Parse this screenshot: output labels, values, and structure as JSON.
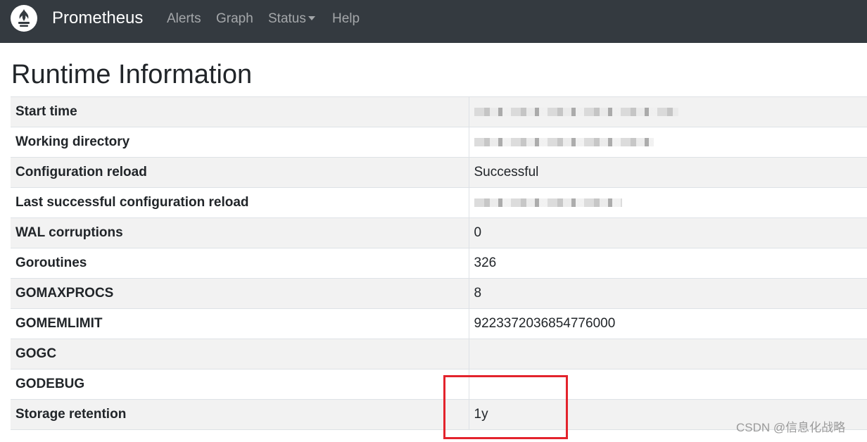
{
  "navbar": {
    "brand": "Prometheus",
    "logo_icon": "prometheus-flame-icon",
    "links": {
      "alerts": "Alerts",
      "graph": "Graph",
      "status": "Status",
      "help": "Help"
    },
    "background_color": "#343a40"
  },
  "page": {
    "title": "Runtime Information"
  },
  "runtime_table": {
    "rows": [
      {
        "key": "Start time",
        "value": "",
        "redacted": true
      },
      {
        "key": "Working directory",
        "value": "",
        "redacted": true
      },
      {
        "key": "Configuration reload",
        "value": "Successful"
      },
      {
        "key": "Last successful configuration reload",
        "value": "",
        "redacted": true
      },
      {
        "key": "WAL corruptions",
        "value": "0"
      },
      {
        "key": "Goroutines",
        "value": "326"
      },
      {
        "key": "GOMAXPROCS",
        "value": "8"
      },
      {
        "key": "GOMEMLIMIT",
        "value": "9223372036854776000"
      },
      {
        "key": "GOGC",
        "value": ""
      },
      {
        "key": "GODEBUG",
        "value": ""
      },
      {
        "key": "Storage retention",
        "value": "1y"
      }
    ]
  },
  "annotation": {
    "highlight_color": "#e3232c"
  },
  "watermark": "CSDN @信息化战略"
}
